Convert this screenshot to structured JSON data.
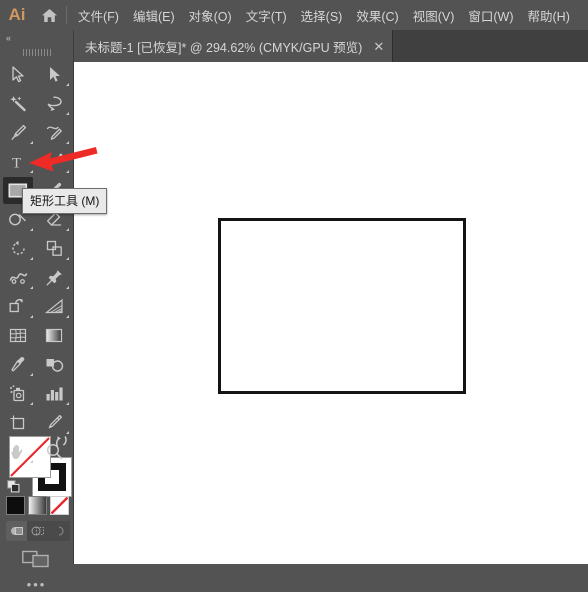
{
  "app": {
    "logo_text": "Ai",
    "logo_color": "#d1975f",
    "home_icon": "home-icon"
  },
  "menubar": {
    "items": [
      {
        "label": "文件(F)",
        "name": "menu-file"
      },
      {
        "label": "编辑(E)",
        "name": "menu-edit"
      },
      {
        "label": "对象(O)",
        "name": "menu-object"
      },
      {
        "label": "文字(T)",
        "name": "menu-type"
      },
      {
        "label": "选择(S)",
        "name": "menu-select"
      },
      {
        "label": "效果(C)",
        "name": "menu-effect"
      },
      {
        "label": "视图(V)",
        "name": "menu-view"
      },
      {
        "label": "窗口(W)",
        "name": "menu-window"
      },
      {
        "label": "帮助(H)",
        "name": "menu-help"
      }
    ]
  },
  "tabbar": {
    "document_title": "未标题-1 [已恢复]* @ 294.62% (CMYK/GPU 预览)",
    "close_label": "✕",
    "zoom_level": "294.62%",
    "color_mode": "CMYK",
    "preview_mode": "GPU 预览",
    "document_name": "未标题-1",
    "document_state": "[已恢复]"
  },
  "toolbar": {
    "collapse_label": "«",
    "grip_name": "toolbar-grip",
    "active_tool": "rectangle-tool",
    "tools": [
      {
        "name": "selection-tool",
        "icon": "arrow-cursor-icon",
        "has_flyout": false
      },
      {
        "name": "direct-selection-tool",
        "icon": "white-arrow-cursor-icon",
        "has_flyout": true
      },
      {
        "name": "magic-wand-tool",
        "icon": "magic-wand-icon",
        "has_flyout": false
      },
      {
        "name": "lasso-tool",
        "icon": "lasso-icon",
        "has_flyout": true
      },
      {
        "name": "pen-tool",
        "icon": "pen-icon",
        "has_flyout": true
      },
      {
        "name": "curvature-tool",
        "icon": "curvature-icon",
        "has_flyout": true
      },
      {
        "name": "type-tool",
        "icon": "type-T-icon",
        "has_flyout": true
      },
      {
        "name": "line-segment-tool",
        "icon": "line-segment-icon",
        "has_flyout": true
      },
      {
        "name": "rectangle-tool",
        "icon": "rectangle-icon",
        "has_flyout": true
      },
      {
        "name": "paintbrush-tool",
        "icon": "paintbrush-icon",
        "has_flyout": true
      },
      {
        "name": "shaper-tool",
        "icon": "shaper-icon",
        "has_flyout": true
      },
      {
        "name": "eraser-tool",
        "icon": "eraser-icon",
        "has_flyout": true
      },
      {
        "name": "rotate-tool",
        "icon": "rotate-icon",
        "has_flyout": true
      },
      {
        "name": "scale-tool",
        "icon": "scale-icon",
        "has_flyout": true
      },
      {
        "name": "width-tool",
        "icon": "width-warp-icon",
        "has_flyout": true
      },
      {
        "name": "free-transform-tool",
        "icon": "pin-icon",
        "has_flyout": true
      },
      {
        "name": "shape-builder-tool",
        "icon": "shape-builder-icon",
        "has_flyout": true
      },
      {
        "name": "perspective-grid-tool",
        "icon": "perspective-grid-icon",
        "has_flyout": true
      },
      {
        "name": "mesh-tool",
        "icon": "mesh-icon",
        "has_flyout": false
      },
      {
        "name": "gradient-tool",
        "icon": "gradient-icon",
        "has_flyout": false
      },
      {
        "name": "eyedropper-tool",
        "icon": "eyedropper-icon",
        "has_flyout": true
      },
      {
        "name": "blend-tool",
        "icon": "blend-icon",
        "has_flyout": false
      },
      {
        "name": "symbol-sprayer-tool",
        "icon": "symbol-sprayer-icon",
        "has_flyout": true
      },
      {
        "name": "column-graph-tool",
        "icon": "bar-chart-icon",
        "has_flyout": true
      },
      {
        "name": "artboard-tool",
        "icon": "artboard-icon",
        "has_flyout": false
      },
      {
        "name": "slice-tool",
        "icon": "slice-knife-icon",
        "has_flyout": true
      },
      {
        "name": "hand-tool",
        "icon": "hand-icon",
        "has_flyout": true
      },
      {
        "name": "zoom-tool",
        "icon": "magnifier-icon",
        "has_flyout": false
      }
    ],
    "edit_toolbar_dots": "•••"
  },
  "color_controls": {
    "fill": {
      "name": "fill-swatch",
      "value": "none",
      "color": "#ffffff",
      "slash_color": "#e8272c"
    },
    "stroke": {
      "name": "stroke-swatch",
      "value": "black",
      "color": "#111111"
    },
    "swap_icon": "swap-fill-stroke-icon",
    "default_icon": "default-fill-stroke-icon",
    "mode_swatches": [
      {
        "name": "color-swatch",
        "icon": "solid-color-icon",
        "selected": false
      },
      {
        "name": "gradient-swatch",
        "icon": "gradient-icon",
        "selected": false
      },
      {
        "name": "none-swatch",
        "icon": "none-slash-icon",
        "selected": true
      }
    ],
    "draw_modes": [
      {
        "name": "draw-normal-mode",
        "icon": "draw-normal-icon",
        "selected": true
      },
      {
        "name": "draw-behind-mode",
        "icon": "draw-behind-icon",
        "selected": false
      },
      {
        "name": "draw-inside-mode",
        "icon": "draw-inside-icon",
        "selected": false
      }
    ],
    "screen_mode": {
      "name": "change-screen-mode",
      "icon": "screen-mode-icon"
    }
  },
  "tooltip": {
    "text": "矩形工具 (M)",
    "tool": "rectangle-tool"
  },
  "annotation": {
    "arrow": {
      "name": "red-arrow-annotation",
      "color": "#ee2b26",
      "points_to": "rectangle-tool"
    }
  },
  "artwork": {
    "shape": {
      "name": "rectangle-shape",
      "fill": "#ffffff",
      "stroke": "#141414",
      "stroke_width": "3"
    }
  },
  "colors": {
    "menubar_bg": "#535353",
    "tabbar_bg": "#404040",
    "panel_bg": "#535353",
    "canvas_bg": "#ffffff",
    "text": "#d6d6d6",
    "accent_red": "#ee2b26"
  }
}
